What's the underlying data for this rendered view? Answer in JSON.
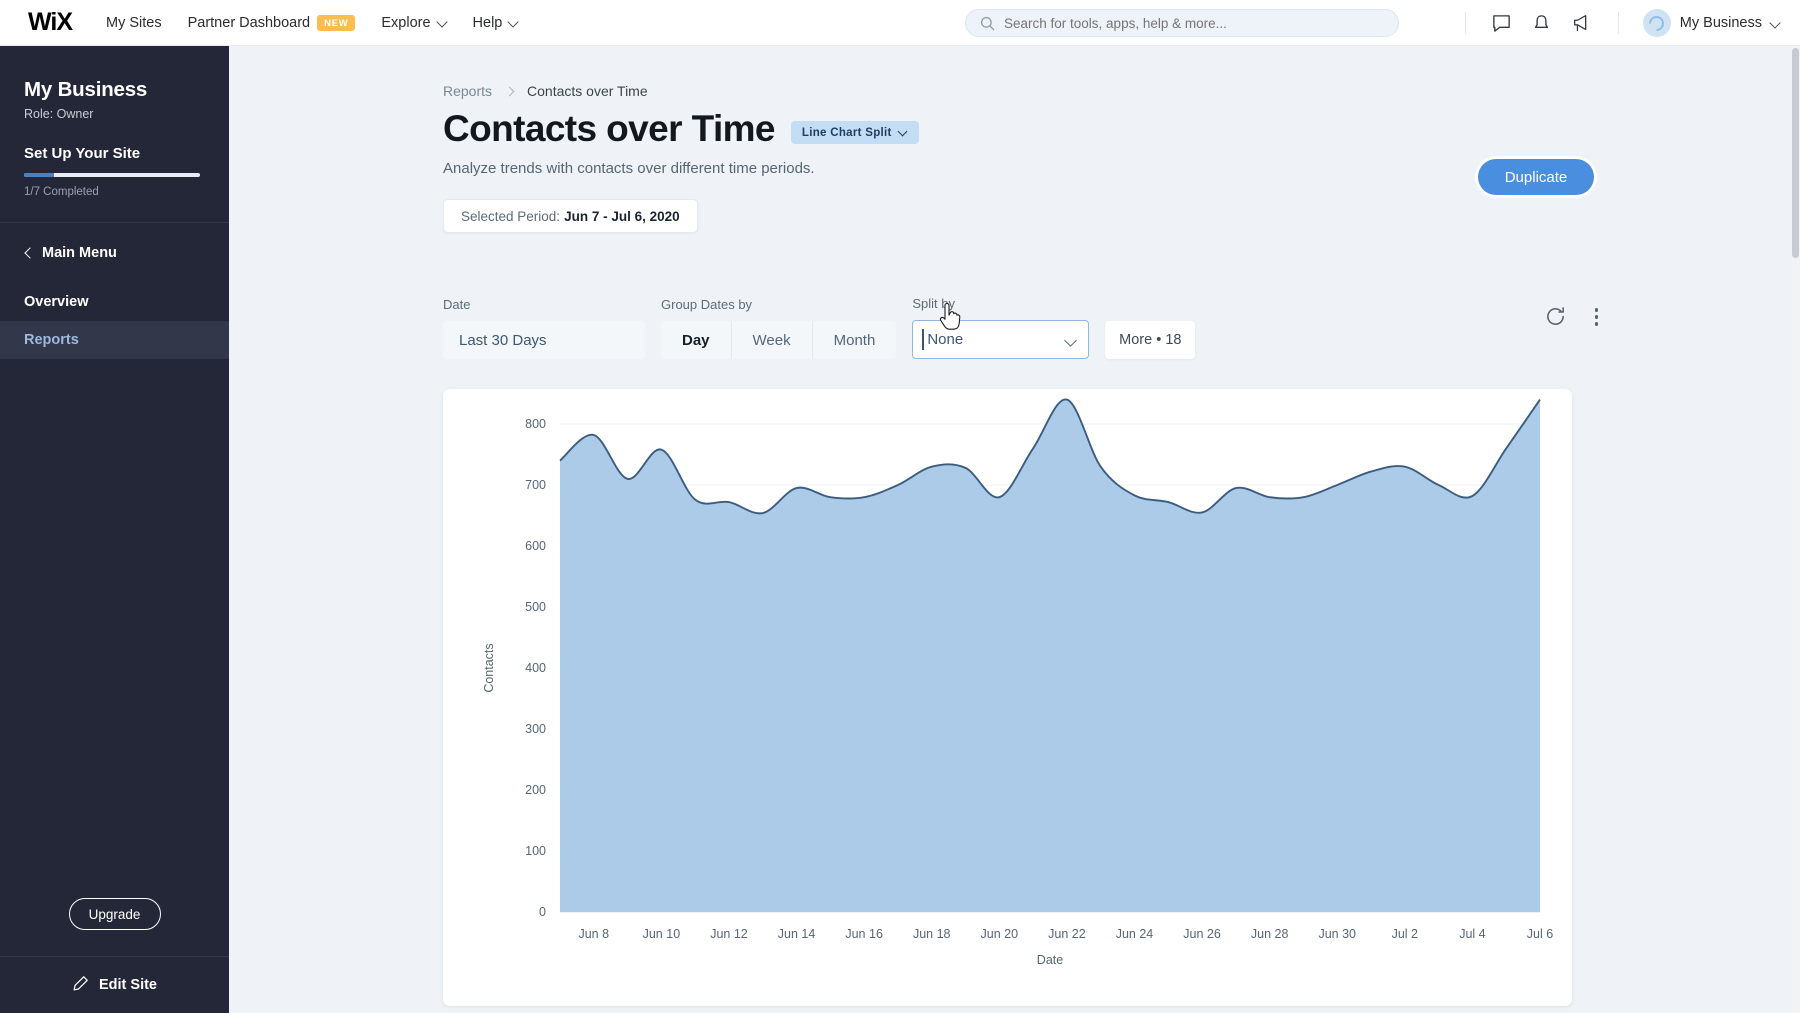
{
  "topbar": {
    "logo": "WiX",
    "nav": [
      {
        "label": "My Sites",
        "caret": false,
        "badge": null
      },
      {
        "label": "Partner Dashboard",
        "caret": false,
        "badge": "NEW"
      },
      {
        "label": "Explore",
        "caret": true,
        "badge": null
      },
      {
        "label": "Help",
        "caret": true,
        "badge": null
      }
    ],
    "search_placeholder": "Search for tools, apps, help & more...",
    "search_value": "",
    "icons": [
      "chat-icon",
      "bell-icon",
      "megaphone-icon"
    ],
    "account_name": "My Business"
  },
  "sidebar": {
    "business_name": "My Business",
    "role": "Role: Owner",
    "setup_title": "Set Up Your Site",
    "setup_progress_label": "1/7 Completed",
    "setup_progress_pct": 17,
    "back_label": "Main Menu",
    "items": [
      {
        "label": "Overview",
        "active": false
      },
      {
        "label": "Reports",
        "active": true
      }
    ],
    "upgrade_label": "Upgrade",
    "edit_site_label": "Edit Site"
  },
  "main": {
    "breadcrumb": {
      "parent": "Reports",
      "current": "Contacts over Time"
    },
    "page_title": "Contacts over Time",
    "chip_label": "Line Chart Split",
    "subtitle": "Analyze trends with contacts over different time periods.",
    "period_label": "Selected Period:",
    "period_value": "Jun 7 - Jul 6, 2020",
    "duplicate_label": "Duplicate",
    "filters": {
      "date_label": "Date",
      "date_value": "Last 30 Days",
      "group_label": "Group Dates by",
      "group_options": [
        "Day",
        "Week",
        "Month"
      ],
      "group_selected": "Day",
      "split_label": "Split by",
      "split_value": "None",
      "more_label": "More • 18"
    },
    "actions": {
      "refresh": "refresh-icon",
      "menu": "kebab-menu-icon"
    }
  },
  "colors": {
    "accent_blue": "#4a8ee0",
    "chip_blue": "#c3ddf5",
    "area_fill": "#a8c8e8",
    "line_stroke": "#3c5d80",
    "sidebar_bg": "#242738",
    "canvas_bg": "#eff3f7",
    "badge_new": "#fbbe4e"
  },
  "chart_data": {
    "type": "area",
    "title": "",
    "xlabel": "Date",
    "ylabel": "Contacts",
    "ylim": [
      0,
      800
    ],
    "yticks": [
      0,
      100,
      200,
      300,
      400,
      500,
      600,
      700,
      800
    ],
    "grid": true,
    "legend": "none",
    "x": [
      "Jun 7",
      "Jun 8",
      "Jun 9",
      "Jun 10",
      "Jun 11",
      "Jun 12",
      "Jun 13",
      "Jun 14",
      "Jun 15",
      "Jun 16",
      "Jun 17",
      "Jun 18",
      "Jun 19",
      "Jun 20",
      "Jun 21",
      "Jun 22",
      "Jun 23",
      "Jun 24",
      "Jun 25",
      "Jun 26",
      "Jun 27",
      "Jun 28",
      "Jun 29",
      "Jun 30",
      "Jul 1",
      "Jul 2",
      "Jul 3",
      "Jul 4",
      "Jul 5",
      "Jul 6"
    ],
    "xticks": [
      "Jun 8",
      "Jun 10",
      "Jun 12",
      "Jun 14",
      "Jun 16",
      "Jun 18",
      "Jun 20",
      "Jun 22",
      "Jun 24",
      "Jun 26",
      "Jun 28",
      "Jun 30",
      "Jul 2",
      "Jul 4",
      "Jul 6"
    ],
    "series": [
      {
        "name": "Contacts",
        "values": [
          740,
          782,
          710,
          758,
          676,
          672,
          654,
          695,
          680,
          680,
          700,
          730,
          728,
          680,
          760,
          840,
          730,
          683,
          672,
          655,
          695,
          680,
          680,
          700,
          722,
          730,
          700,
          682,
          760,
          840
        ]
      }
    ]
  }
}
